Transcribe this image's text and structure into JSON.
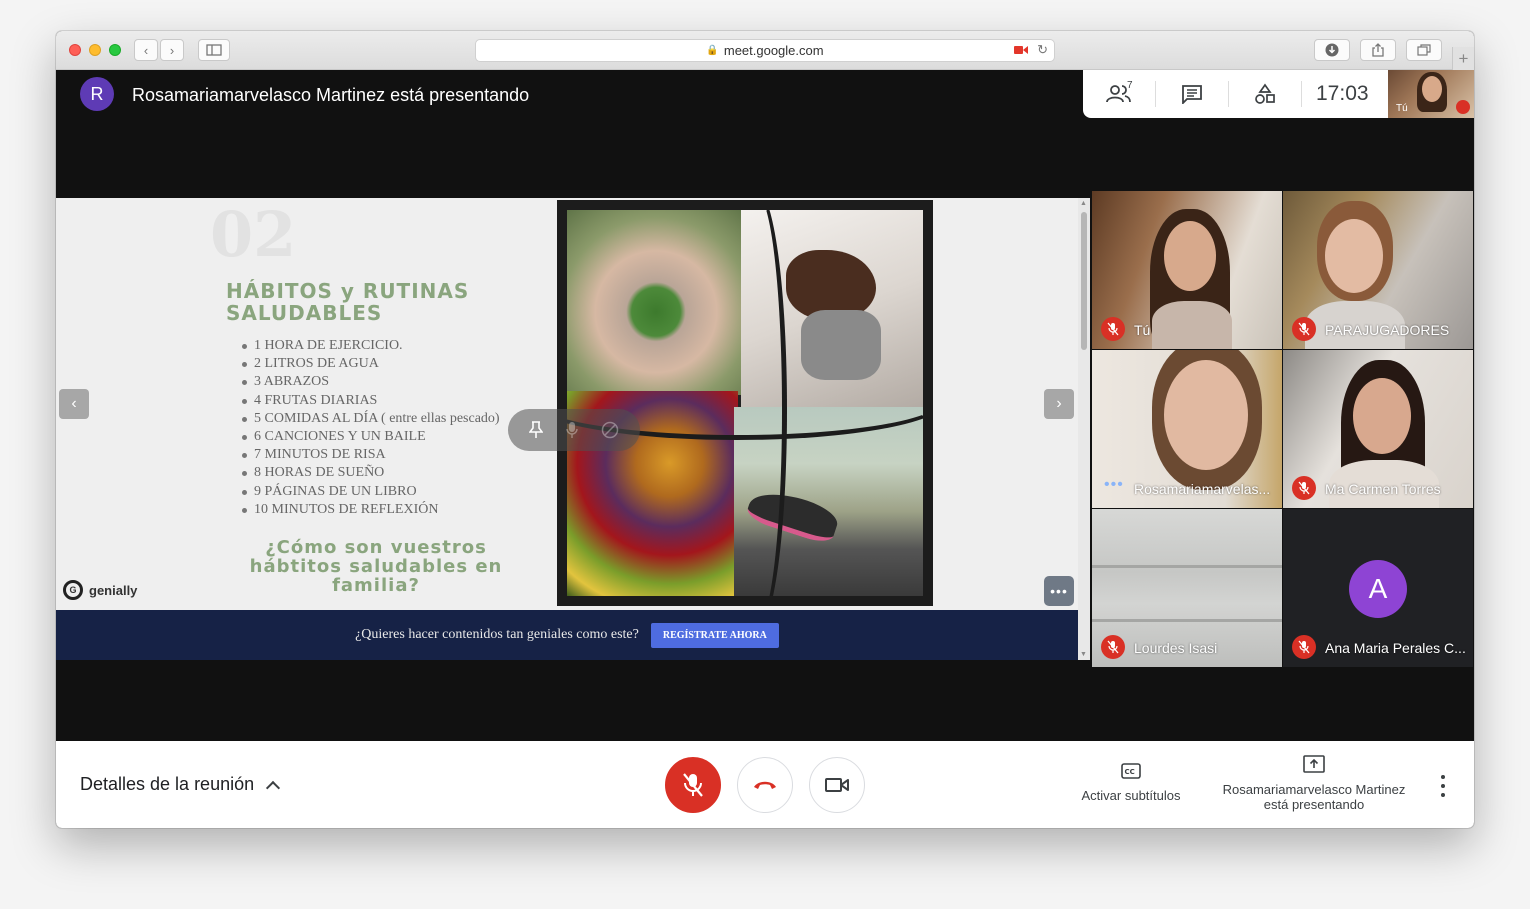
{
  "browser": {
    "url": "meet.google.com"
  },
  "meeting": {
    "presenter_initial": "R",
    "presenter_title": "Rosamariamarvelasco Martinez está presentando",
    "people_count": "7",
    "time": "17:03",
    "self_label": "Tú"
  },
  "slide": {
    "number": "02",
    "heading": "HÁBITOS y RUTINAS SALUDABLES",
    "items": [
      "1 HORA DE EJERCICIO.",
      "2 LITROS DE AGUA",
      "3 ABRAZOS",
      "4 FRUTAS DIARIAS",
      "5 COMIDAS AL DÍA ( entre ellas pescado)",
      "6 CANCIONES Y UN BAILE",
      "7 MINUTOS DE RISA",
      "8 HORAS DE SUEÑO",
      "9 PÁGINAS DE UN LIBRO",
      "10 MINUTOS DE REFLEXIÓN"
    ],
    "question": "¿Cómo son vuestros hábtitos saludables en familia?",
    "brand": "genially",
    "banner_text": "¿Quieres hacer contenidos tan geniales como este?",
    "banner_button": "REGÍSTRATE AHORA",
    "prev_icon": "‹",
    "next_icon": "›"
  },
  "participants": [
    {
      "name": "Tú",
      "status": "muted"
    },
    {
      "name": "PARAJUGADORES",
      "status": "muted"
    },
    {
      "name": "Rosamariamarvelas...",
      "status": "speaking"
    },
    {
      "name": "Ma Carmen Torres",
      "status": "muted"
    },
    {
      "name": "Lourdes Isasi",
      "status": "muted"
    },
    {
      "name": "Ana Maria Perales C...",
      "status": "muted",
      "avatar_initial": "A"
    }
  ],
  "bottom": {
    "details_label": "Detalles de la reunión",
    "captions_label": "Activar subtítulos",
    "presenting_label": "Rosamariamarvelasco Martinez está presentando"
  },
  "colors": {
    "muted_red": "#d93025",
    "slide_green": "#8aa57e",
    "banner_navy": "#162246"
  }
}
